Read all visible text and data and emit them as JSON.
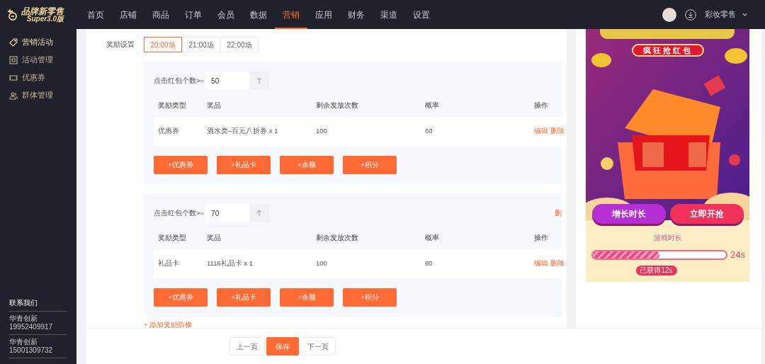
{
  "logo": {
    "name": "品牌新零售",
    "subtitle": "Super3.0版"
  },
  "nav": [
    {
      "label": "首页",
      "selected": false
    },
    {
      "label": "店铺",
      "selected": false
    },
    {
      "label": "商品",
      "selected": false
    },
    {
      "label": "订单",
      "selected": false
    },
    {
      "label": "会员",
      "selected": false
    },
    {
      "label": "数据",
      "selected": false
    },
    {
      "label": "营销",
      "selected": true
    },
    {
      "label": "应用",
      "selected": false
    },
    {
      "label": "财务",
      "selected": false
    },
    {
      "label": "渠道",
      "selected": false
    },
    {
      "label": "设置",
      "selected": false
    }
  ],
  "user": {
    "store": "彩妆零售"
  },
  "sidebar": {
    "items": [
      {
        "label": "营销活动",
        "selected": true
      },
      {
        "label": "活动管理",
        "selected": false
      },
      {
        "label": "优惠券",
        "selected": false
      },
      {
        "label": "群体管理",
        "selected": false
      }
    ],
    "contact_title": "联系我们",
    "contacts": [
      {
        "name": "华青创新",
        "phone": "19952409917"
      },
      {
        "name": "华青创新",
        "phone": "15001309732"
      }
    ]
  },
  "reward": {
    "label": "奖励设置",
    "sessions": [
      {
        "label": "20:00场",
        "selected": true
      },
      {
        "label": "21:00场",
        "selected": false
      },
      {
        "label": "22:00场",
        "selected": false
      }
    ],
    "tiers": [
      {
        "label": "点击红包个数>=",
        "value": "50",
        "columns": [
          "奖励类型",
          "奖品",
          "剩余发放次数",
          "概率",
          "操作"
        ],
        "rows": [
          {
            "type": "优惠券",
            "prize": "酒水类–百元八折券 x 1",
            "remaining": "100",
            "rate": "60",
            "actions": [
              "编辑",
              "删除"
            ]
          }
        ],
        "buttons": [
          "+优惠券",
          "+礼品卡",
          "+余额",
          "+积分"
        ]
      },
      {
        "label": "点击红包个数>=",
        "value": "70",
        "side_action": "删",
        "columns": [
          "奖励类型",
          "奖品",
          "剩余发放次数",
          "概率",
          "操作"
        ],
        "rows": [
          {
            "type": "礼品卡",
            "prize": "1116礼品卡 x 1",
            "remaining": "100",
            "rate": "80",
            "actions": [
              "编辑",
              "删除"
            ]
          }
        ],
        "buttons": [
          "+优惠券",
          "+礼品卡",
          "+余额",
          "+积分"
        ]
      }
    ],
    "add_tier": "+ 添加奖励阶梯"
  },
  "preview": {
    "banner": "疯狂抢红包",
    "buttons": [
      {
        "label": "增长时长",
        "kind": "extend"
      },
      {
        "label": "立即开抢",
        "kind": "start"
      }
    ],
    "timer_label": "游戏时长",
    "level": 0.5,
    "total": "24s",
    "earned": "已获得12s"
  },
  "footer": {
    "buttons": [
      {
        "label": "上一页",
        "primary": false
      },
      {
        "label": "保存",
        "primary": true
      },
      {
        "label": "下一页",
        "primary": false
      }
    ]
  }
}
